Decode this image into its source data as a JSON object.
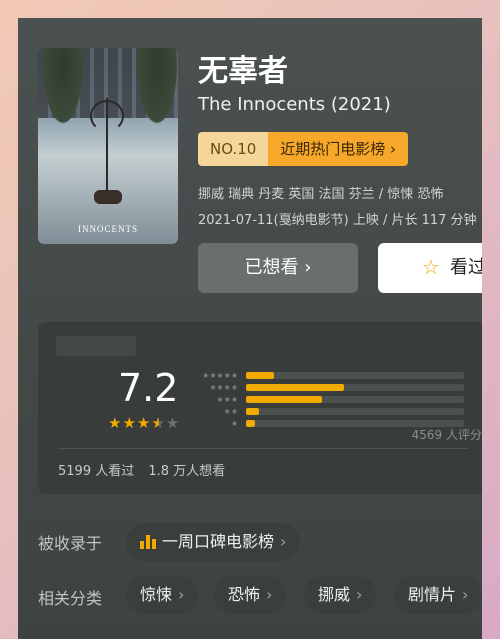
{
  "movie": {
    "title_cn": "无辜者",
    "title_en": "The Innocents (2021)",
    "poster_title": "INNOCENTS",
    "rank_no": "NO.10",
    "rank_list": "近期热门电影榜 ›",
    "meta_line1": "挪威 瑞典 丹麦 英国 法国 芬兰 / 惊悚 恐怖",
    "meta_line2": "2021-07-11(戛纳电影节) 上映 / 片长 117 分钟"
  },
  "actions": {
    "want_label": "已想看 ›",
    "seen_label": "看过"
  },
  "rating": {
    "score": "7.2",
    "stars_on": "★★★",
    "star_half": "★",
    "stars_off": "★",
    "distribution": [
      {
        "stars": "★★★★★",
        "percent": 13
      },
      {
        "stars": "★★★★",
        "percent": 45
      },
      {
        "stars": "★★★",
        "percent": 35
      },
      {
        "stars": "★★",
        "percent": 6
      },
      {
        "stars": "★",
        "percent": 4
      }
    ],
    "raters": "4569 人评分",
    "watched": "5199 人看过",
    "want": "1.8 万人想看"
  },
  "collected": {
    "label": "被收录于",
    "item": "一周口碑电影榜"
  },
  "related": {
    "label": "相关分类",
    "tags": [
      "惊悚",
      "恐怖",
      "挪威",
      "剧情片"
    ]
  },
  "colors": {
    "accent": "#f2a900",
    "rank_badge_light": "#f6d59a",
    "rank_badge_dark": "#f7a82b"
  }
}
